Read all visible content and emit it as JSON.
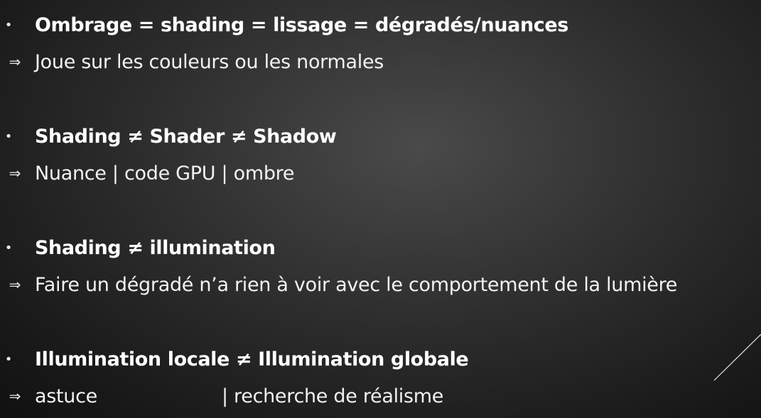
{
  "blocks": [
    {
      "bullet": "•",
      "heading": "Ombrage = shading = lissage = dégradés/nuances",
      "arrow": "⇒",
      "detail": "Joue sur les couleurs ou les normales"
    },
    {
      "bullet": "•",
      "heading": "Shading ≠ Shader ≠ Shadow",
      "arrow": "⇒",
      "detail": "Nuance | code GPU | ombre"
    },
    {
      "bullet": "•",
      "heading": "Shading ≠ illumination",
      "arrow": "⇒",
      "detail": "Faire un dégradé n’a rien à voir avec le comportement de la lumière"
    },
    {
      "bullet": "•",
      "heading": "Illumination locale ≠ Illumination globale",
      "arrow": "⇒",
      "detail_left": "astuce",
      "detail_right": "| recherche de réalisme"
    }
  ],
  "decoration": {
    "accent_color": "#ffffff"
  }
}
